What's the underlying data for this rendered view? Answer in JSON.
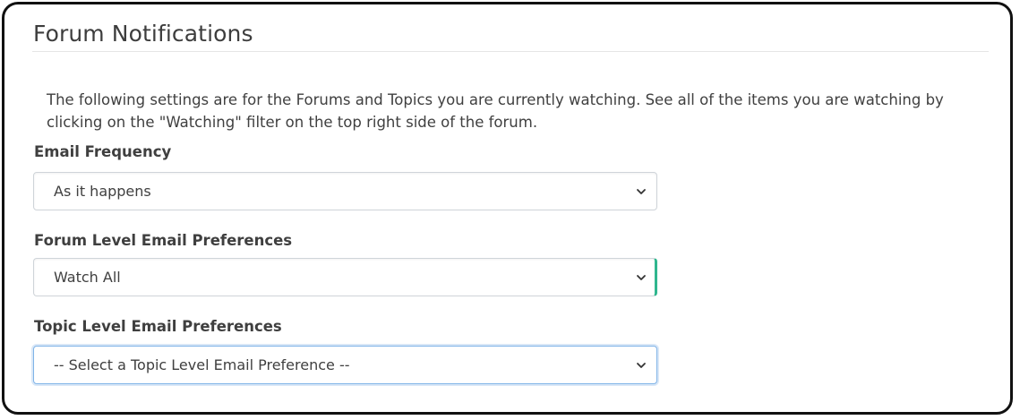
{
  "panel": {
    "title": "Forum Notifications",
    "intro": "The following settings are for the Forums and Topics you are currently watching. See all of the items you are watching by clicking on the \"Watching\" filter on the top right side of the forum."
  },
  "fields": [
    {
      "label": "Email Frequency",
      "value": "As it happens",
      "icon": "chevron-down-icon"
    },
    {
      "label": "Forum Level Email Preferences",
      "value": "Watch All",
      "icon": "chevron-down-icon"
    },
    {
      "label": "Topic Level Email Preferences",
      "value": "-- Select a Topic Level Email Preference --",
      "icon": "chevron-down-icon"
    }
  ],
  "colors": {
    "focus_green": "#2fb68e",
    "focus_blue": "#80b4e8",
    "frame_border": "#111111"
  }
}
